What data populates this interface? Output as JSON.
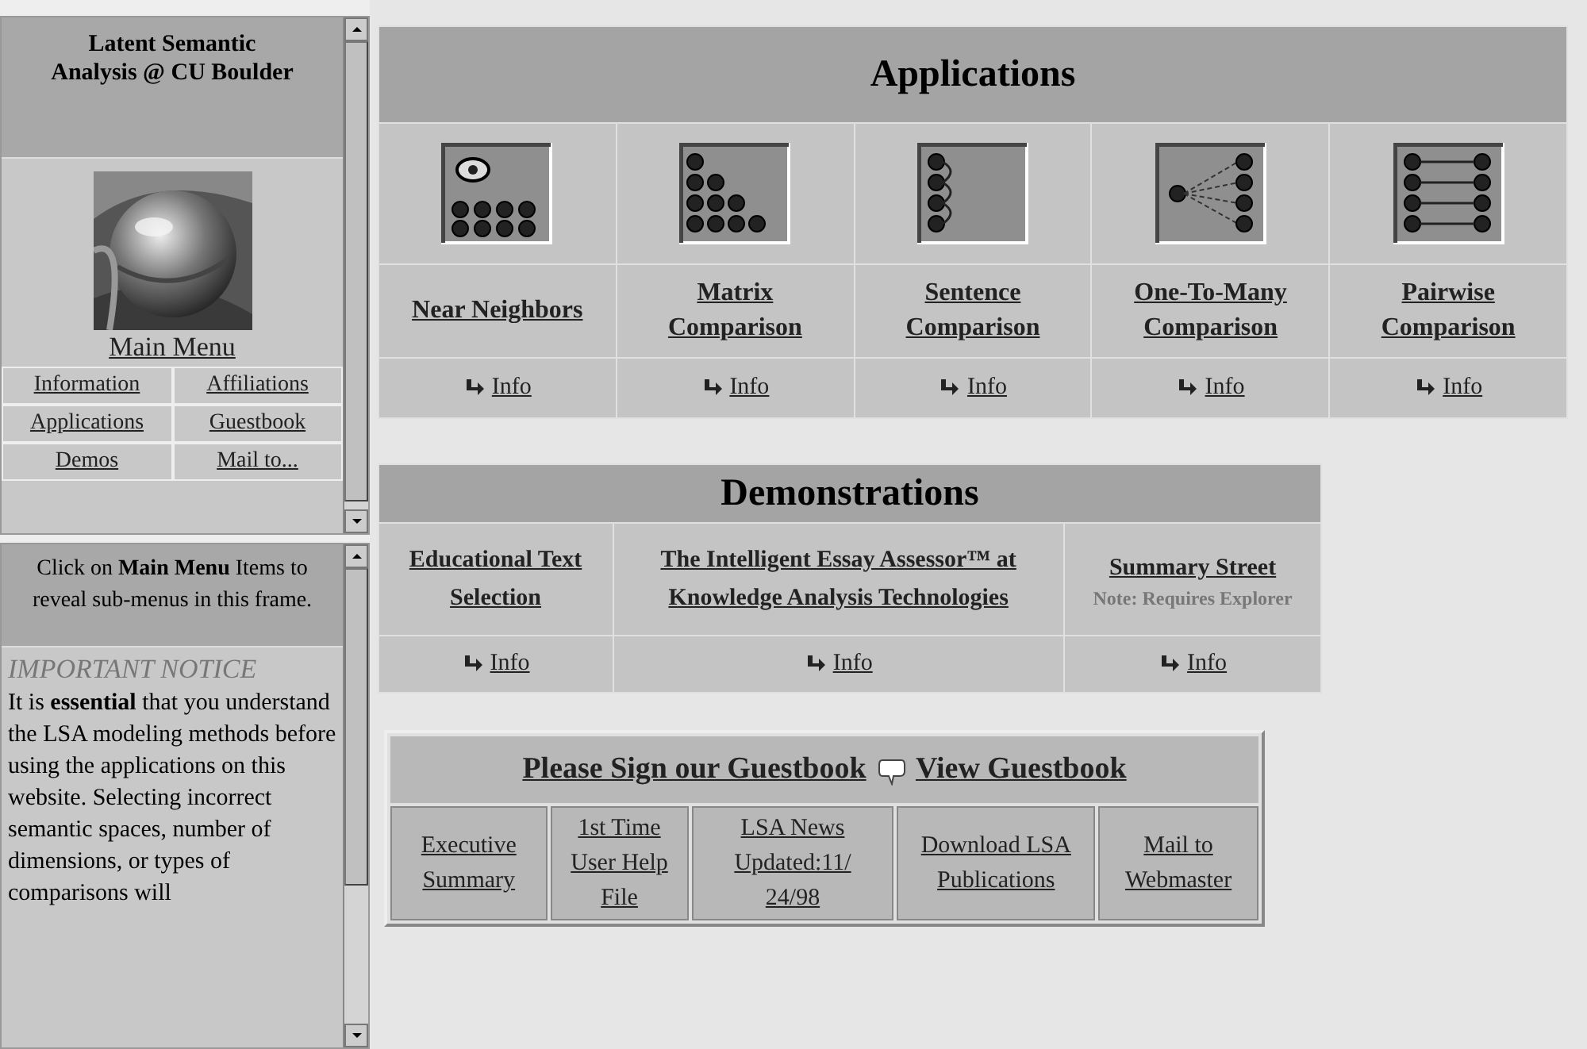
{
  "top_frame": {
    "title": "Latent Semantic Analysis @ CU Boulder",
    "main_menu": "Main Menu",
    "menu_items": [
      {
        "label": "Information"
      },
      {
        "label": "Affiliations"
      },
      {
        "label": "Applications"
      },
      {
        "label": "Guestbook"
      },
      {
        "label": "Demos"
      },
      {
        "label": "Mail to..."
      }
    ]
  },
  "bottom_frame": {
    "hint": "Click on **Main Menu** Items to reveal sub-menus in this frame.",
    "notice_title": "IMPORTANT NOTICE",
    "notice": "It is **essential** that you understand the LSA modeling methods before using the applications on this website. Selecting incorrect semantic spaces, number of dimensions, or types of comparisons will"
  },
  "applications": {
    "title": "Applications",
    "items": [
      {
        "label": "Near Neighbors",
        "info": "Info"
      },
      {
        "label": "Matrix Comparison",
        "info": "Info"
      },
      {
        "label": "Sentence Comparison",
        "info": "Info"
      },
      {
        "label": "One-To-Many Comparison",
        "info": "Info"
      },
      {
        "label": "Pairwise Comparison",
        "info": "Info"
      }
    ]
  },
  "demonstrations": {
    "title": "Demonstrations",
    "items": [
      {
        "label": "Educational Text Selection",
        "info": "Info"
      },
      {
        "label": "The Intelligent Essay Assessor™ at Knowledge Analysis Technologies",
        "info": "Info"
      },
      {
        "label": "Summary Street",
        "note": "Note: Requires Explorer",
        "info": "Info"
      }
    ]
  },
  "guestbook": {
    "sign": "Please Sign our Guestbook",
    "view": "View Guestbook",
    "links": [
      {
        "label": "Executive Summary"
      },
      {
        "label": "1st Time User Help File"
      },
      {
        "label": "LSA News Updated:11/ 24/98"
      },
      {
        "label": "Download LSA Publications"
      },
      {
        "label": "Mail to Webmaster"
      }
    ]
  }
}
